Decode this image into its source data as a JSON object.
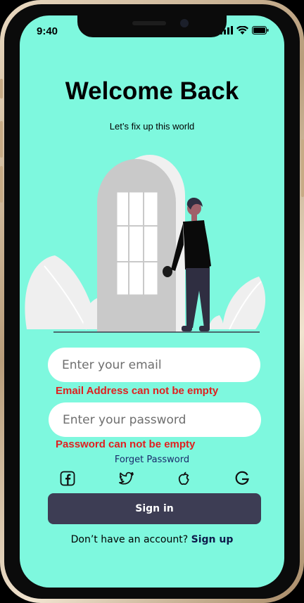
{
  "status_bar": {
    "time": "9:40"
  },
  "header": {
    "title": "Welcome Back",
    "subtitle": "Let’s fix up this world"
  },
  "form": {
    "email_placeholder": "Enter your email",
    "email_error": "Email Address can not be empty",
    "password_placeholder": "Enter your password",
    "password_error": "Password can not be empty",
    "forget_password": "Forget Password"
  },
  "social": [
    "facebook-icon",
    "twitter-icon",
    "apple-icon",
    "google-icon"
  ],
  "actions": {
    "signin_label": "Sign in"
  },
  "footer": {
    "signup_prompt": "Don’t have an account?",
    "signup_link": "Sign up"
  },
  "colors": {
    "background": "#7ef8de",
    "button": "#3d3d54",
    "error": "#e02020",
    "link": "#19296a"
  }
}
